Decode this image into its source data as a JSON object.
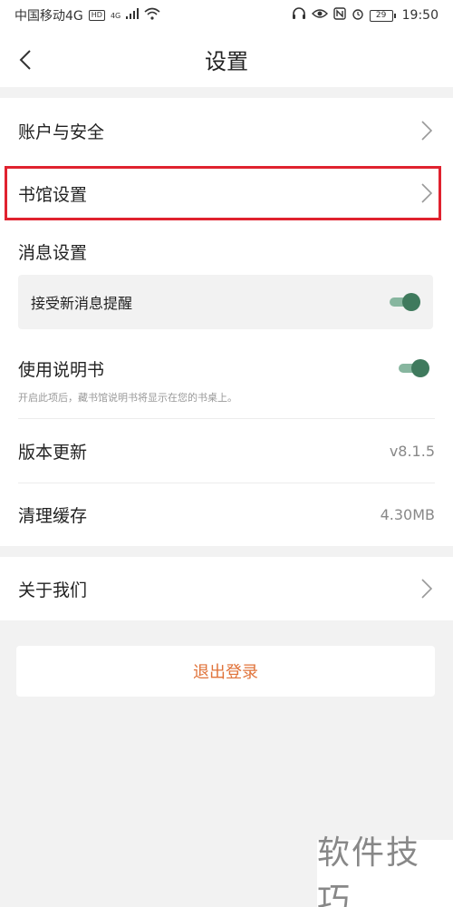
{
  "status_bar": {
    "carrier": "中国移动4G",
    "hd_badge": "HD",
    "network_badge": "4G",
    "battery": "29",
    "time": "19:50",
    "icons": [
      "signal-icon",
      "wifi-icon",
      "headset-icon",
      "eye-icon",
      "nfc-icon",
      "alarm-icon",
      "battery-icon"
    ]
  },
  "nav": {
    "back_icon": "chevron-left-icon",
    "title": "设置"
  },
  "settings": {
    "account_security": "账户与安全",
    "library_settings": "书馆设置",
    "message_settings": "消息设置",
    "new_message_alert": "接受新消息提醒",
    "new_message_alert_on": true,
    "user_manual": "使用说明书",
    "user_manual_on": true,
    "user_manual_hint": "开启此项后，藏书馆说明书将显示在您的书桌上。",
    "version_update": "版本更新",
    "version_value": "v8.1.5",
    "clear_cache": "清理缓存",
    "cache_value": "4.30MB",
    "about_us": "关于我们"
  },
  "logout": {
    "label": "退出登录"
  },
  "watermark": {
    "text": "软件技巧"
  },
  "colors": {
    "accent_toggle": "#3f7a5d",
    "logout_text": "#e0733a",
    "highlight": "#e0222f",
    "background": "#f2f2f2"
  }
}
